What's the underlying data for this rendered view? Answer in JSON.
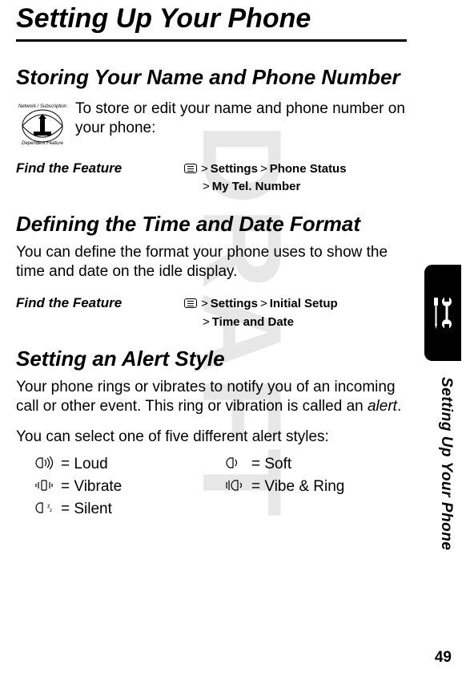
{
  "watermark": "DRAFT",
  "page_title": "Setting Up Your Phone",
  "side_label": "Setting Up Your Phone",
  "page_number": "49",
  "section1": {
    "heading": "Storing Your Name and Phone Number",
    "intro": "To store or edit your name and phone number on your phone:",
    "find_label": "Find the Feature",
    "path_settings": "Settings",
    "path_phone_status": "Phone Status",
    "path_my_tel": "My Tel. Number"
  },
  "section2": {
    "heading": "Defining the Time and Date Format",
    "body": "You can define the format your phone uses to show the time and date on the idle display.",
    "find_label": "Find the Feature",
    "path_settings": "Settings",
    "path_initial_setup": "Initial Setup",
    "path_time_date": "Time and Date"
  },
  "section3": {
    "heading": "Setting an Alert Style",
    "body1_a": "Your phone rings or vibrates to notify you of an incoming call or other event. This ring or vibration is called an ",
    "body1_b": "alert",
    "body1_c": ".",
    "body2": "You can select one of five different alert styles:",
    "alerts": {
      "loud": "= Loud",
      "soft": "= Soft",
      "vibrate": "= Vibrate",
      "vibe_ring": "= Vibe & Ring",
      "silent": "= Silent"
    }
  },
  "gt": ">"
}
